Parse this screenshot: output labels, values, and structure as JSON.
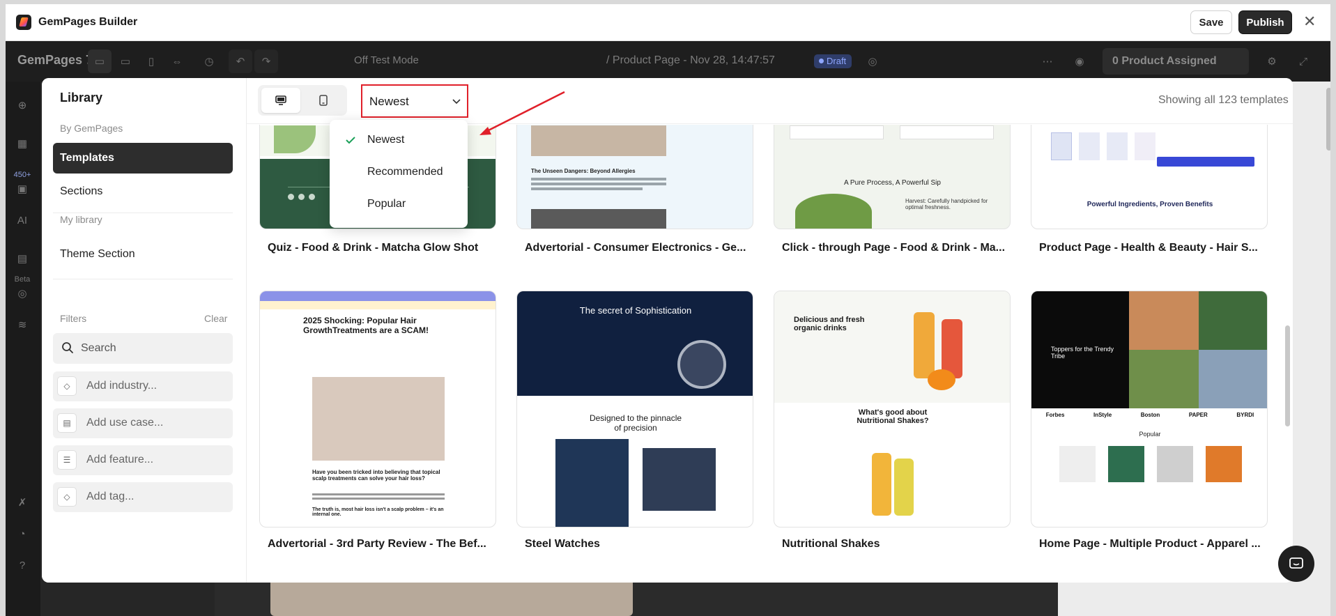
{
  "window": {
    "title": "GemPages Builder",
    "save_label": "Save",
    "publish_label": "Publish"
  },
  "editor": {
    "brand": "GemPages 7",
    "test_mode": "Off Test Mode",
    "page_title": "/ Product Page - Nov 28, 14:47:57",
    "status_badge": "Draft",
    "products_assigned": "0 Product Assigned",
    "rail_badge": "450+",
    "rail_beta": "Beta"
  },
  "library": {
    "title": "Library",
    "by_gempages": "By GemPages",
    "items": [
      "Templates",
      "Sections"
    ],
    "my_library": "My library",
    "my_items": [
      "Theme Section"
    ],
    "filters_label": "Filters",
    "clear_label": "Clear",
    "search_placeholder": "Search",
    "filter_rows": [
      {
        "label": "Add industry...",
        "icon": "tag-icon"
      },
      {
        "label": "Add use case...",
        "icon": "document-icon"
      },
      {
        "label": "Add feature...",
        "icon": "sliders-icon"
      },
      {
        "label": "Add tag...",
        "icon": "tag-icon"
      }
    ]
  },
  "toolbar": {
    "sort_value": "Newest",
    "sort_options": [
      "Newest",
      "Recommended",
      "Popular"
    ],
    "showing": "Showing all 123 templates"
  },
  "templates": [
    {
      "title": "Quiz - Food & Drink - Matcha Glow Shot"
    },
    {
      "title": "Advertorial - Consumer Electronics - Ge..."
    },
    {
      "title": "Click - through Page - Food & Drink - Ma..."
    },
    {
      "title": "Product Page - Health & Beauty - Hair S..."
    },
    {
      "title": "Advertorial - 3rd Party Review - The Bef..."
    },
    {
      "title": "Steel Watches"
    },
    {
      "title": "Nutritional Shakes"
    },
    {
      "title": "Home Page - Multiple Product - Apparel ..."
    }
  ],
  "thumb_text": {
    "t2_heading": "The Unseen Dangers: Beyond Allergies",
    "t3_heading": "A Pure Process, A Powerful Sip",
    "t3_sub": "Harvest: Carefully handpicked for optimal freshness.",
    "t4_heading": "Powerful Ingredients, Proven Benefits",
    "t5_heading": "2025 Shocking: Popular Hair GrowthTreatments are a SCAM!",
    "t5_sub": "Have you been tricked into believing that topical scalp treatments can solve your hair loss?",
    "t5_sub2": "The truth is, most hair loss isn't a scalp problem – it's an internal one.",
    "t6_heading": "The secret of Sophistication",
    "t6_sub": "Designed to the pinnacle of precision",
    "t7_heading": "Delicious and fresh organic drinks",
    "t7_sub": "What's good about Nutritional Shakes?",
    "t8_heading": "Toppers for the Trendy Tribe",
    "t8_sub": "Popular",
    "t8_brands": [
      "Forbes",
      "InStyle",
      "Boston",
      "PAPER",
      "BYRDI"
    ]
  }
}
